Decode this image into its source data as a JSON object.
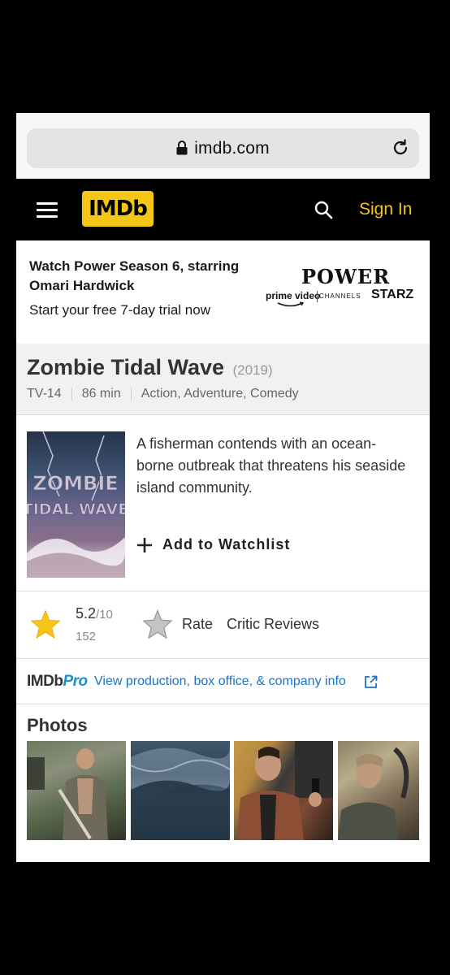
{
  "browser": {
    "url": "imdb.com",
    "icons": [
      "lock-icon",
      "reload-icon"
    ]
  },
  "header": {
    "logo": "IMDb",
    "sign_in": "Sign In",
    "colors": {
      "brand": "#f5c518",
      "background": "#000000"
    }
  },
  "promo": {
    "title": "Watch Power Season 6, starring Omari Hardwick",
    "subtitle": "Start your free 7-day trial now",
    "logo_power": "POWER",
    "logo_prime": "prime video",
    "logo_channels": "CHANNELS",
    "logo_starz": "STARZ"
  },
  "title": {
    "name": "Zombie Tidal Wave",
    "year": "(2019)",
    "rating": "TV-14",
    "runtime": "86 min",
    "genres": "Action, Adventure, Comedy"
  },
  "overview": {
    "plot": "A fisherman contends with an ocean-borne outbreak that threatens his seaside island community.",
    "watchlist_label": "Add to Watchlist",
    "poster_line1": "ZOMBIE",
    "poster_line2": "TIDAL WAVE"
  },
  "ratings": {
    "value": "5.2",
    "max": "/10",
    "count": "152",
    "rate_label": "Rate",
    "critic_label": "Critic Reviews"
  },
  "pro": {
    "logo_imdb": "IMDb",
    "logo_pro": "Pro",
    "link_text": "View production, box office, & company info"
  },
  "photos": {
    "title": "Photos"
  }
}
